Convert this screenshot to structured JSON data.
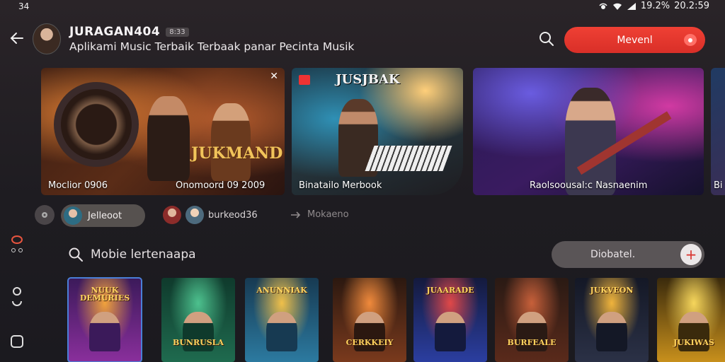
{
  "status_bar": {
    "time": "34",
    "battery": "19.2%",
    "clock": "20.2:59"
  },
  "header": {
    "channel_name": "JURAGAN404",
    "badge": "8:33",
    "subtitle": "Aplikami Music Terbaik Terbaak panar Pecinta Musik",
    "primary_button": "Mevenl"
  },
  "banners": [
    {
      "logo": "JUKMAND",
      "caption_left": "Moclior 0906",
      "caption_right": "Onomoord 09 2009"
    },
    {
      "logo": "JUSJBAK",
      "caption": "Binatailo Merbook"
    },
    {
      "caption": "Raolsoousal:c Nasnaenim"
    },
    {
      "caption": "Bi"
    }
  ],
  "chips": {
    "active": "Jelleoot",
    "pair": "burkeod36",
    "link": "Mokaeno"
  },
  "search": {
    "placeholder": "Mobie lertenaapa"
  },
  "pill_button": "Diobatel.",
  "albums": [
    {
      "title": "NUUK DEMURIES",
      "colors": [
        "#3b1a5a",
        "#8a2f9c",
        "#f0a23c"
      ]
    },
    {
      "title": "BUNRUSLA",
      "colors": [
        "#0f3a2c",
        "#1f6b4f",
        "#4dc18e"
      ]
    },
    {
      "title": "ANUNNIAK",
      "colors": [
        "#173a52",
        "#2c7aa0",
        "#f0c04a"
      ]
    },
    {
      "title": "CERKKEIY",
      "colors": [
        "#2b1810",
        "#7a3a1d",
        "#f08a3c"
      ]
    },
    {
      "title": "JUAARADE",
      "colors": [
        "#141a3d",
        "#2b3ea0",
        "#e04848"
      ]
    },
    {
      "title": "BURFEALE",
      "colors": [
        "#2a1a14",
        "#5a2a1b",
        "#c7603a"
      ]
    },
    {
      "title": "JUKVEON",
      "colors": [
        "#141826",
        "#2b3146",
        "#f0b43c"
      ]
    },
    {
      "title": "JUKIWAS",
      "colors": [
        "#3a2a0c",
        "#c8901c",
        "#f6d65c"
      ]
    }
  ]
}
